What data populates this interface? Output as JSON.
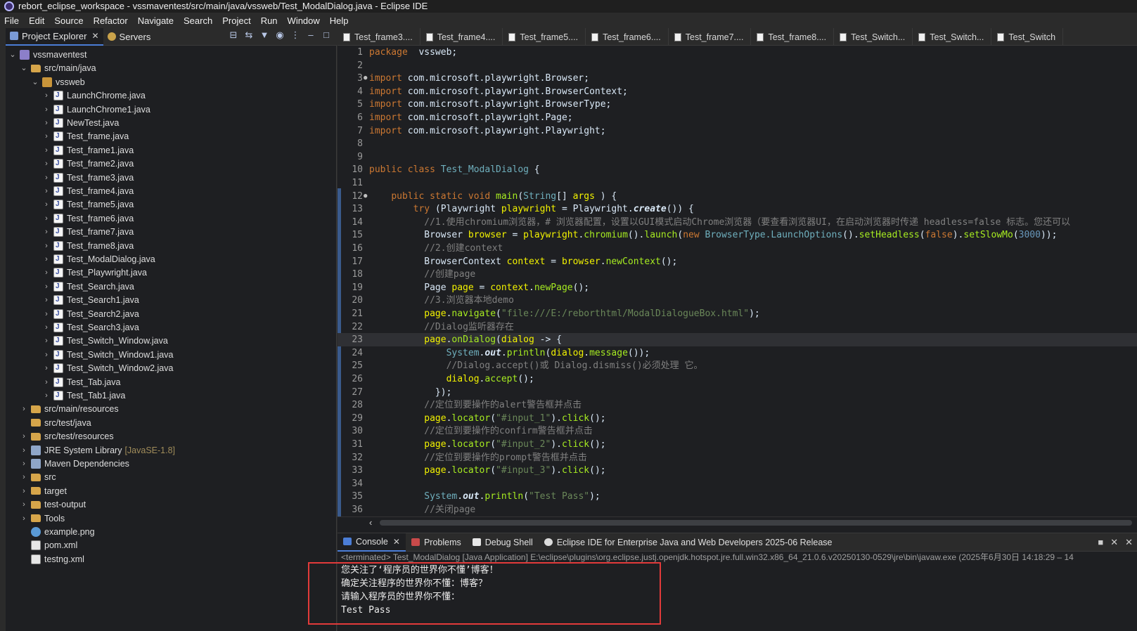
{
  "window": {
    "title": "rebort_eclipse_workspace - vssmaventest/src/main/java/vssweb/Test_ModalDialog.java - Eclipse IDE"
  },
  "menu": [
    "File",
    "Edit",
    "Source",
    "Refactor",
    "Navigate",
    "Search",
    "Project",
    "Run",
    "Window",
    "Help"
  ],
  "left_tabs": {
    "project_explorer": "Project Explorer",
    "servers": "Servers"
  },
  "tree": [
    {
      "label": "vssmaventest",
      "icon": "project",
      "level": 0,
      "chevron": "v"
    },
    {
      "label": "src/main/java",
      "icon": "folder",
      "level": 1,
      "chevron": "v"
    },
    {
      "label": "vssweb",
      "icon": "pkg",
      "level": 2,
      "chevron": "v"
    },
    {
      "label": "LaunchChrome.java",
      "icon": "java",
      "level": 3,
      "chevron": ">"
    },
    {
      "label": "LaunchChrome1.java",
      "icon": "java",
      "level": 3,
      "chevron": ">"
    },
    {
      "label": "NewTest.java",
      "icon": "java",
      "level": 3,
      "chevron": ">"
    },
    {
      "label": "Test_frame.java",
      "icon": "java",
      "level": 3,
      "chevron": ">"
    },
    {
      "label": "Test_frame1.java",
      "icon": "java",
      "level": 3,
      "chevron": ">"
    },
    {
      "label": "Test_frame2.java",
      "icon": "java",
      "level": 3,
      "chevron": ">"
    },
    {
      "label": "Test_frame3.java",
      "icon": "java",
      "level": 3,
      "chevron": ">"
    },
    {
      "label": "Test_frame4.java",
      "icon": "java",
      "level": 3,
      "chevron": ">"
    },
    {
      "label": "Test_frame5.java",
      "icon": "java",
      "level": 3,
      "chevron": ">"
    },
    {
      "label": "Test_frame6.java",
      "icon": "java",
      "level": 3,
      "chevron": ">"
    },
    {
      "label": "Test_frame7.java",
      "icon": "java",
      "level": 3,
      "chevron": ">"
    },
    {
      "label": "Test_frame8.java",
      "icon": "java",
      "level": 3,
      "chevron": ">"
    },
    {
      "label": "Test_ModalDialog.java",
      "icon": "java",
      "level": 3,
      "chevron": ">"
    },
    {
      "label": "Test_Playwright.java",
      "icon": "java",
      "level": 3,
      "chevron": ">"
    },
    {
      "label": "Test_Search.java",
      "icon": "java",
      "level": 3,
      "chevron": ">"
    },
    {
      "label": "Test_Search1.java",
      "icon": "java",
      "level": 3,
      "chevron": ">"
    },
    {
      "label": "Test_Search2.java",
      "icon": "java",
      "level": 3,
      "chevron": ">"
    },
    {
      "label": "Test_Search3.java",
      "icon": "java",
      "level": 3,
      "chevron": ">"
    },
    {
      "label": "Test_Switch_Window.java",
      "icon": "java",
      "level": 3,
      "chevron": ">"
    },
    {
      "label": "Test_Switch_Window1.java",
      "icon": "java",
      "level": 3,
      "chevron": ">"
    },
    {
      "label": "Test_Switch_Window2.java",
      "icon": "java",
      "level": 3,
      "chevron": ">"
    },
    {
      "label": "Test_Tab.java",
      "icon": "java",
      "level": 3,
      "chevron": ">"
    },
    {
      "label": "Test_Tab1.java",
      "icon": "java",
      "level": 3,
      "chevron": ">"
    },
    {
      "label": "src/main/resources",
      "icon": "folder",
      "level": 1,
      "chevron": ">"
    },
    {
      "label": "src/test/java",
      "icon": "folder",
      "level": 1,
      "chevron": ""
    },
    {
      "label": "src/test/resources",
      "icon": "folder",
      "level": 1,
      "chevron": ">"
    },
    {
      "label": "JRE System Library",
      "icon": "lib",
      "level": 1,
      "chevron": ">",
      "decoration": "[JavaSE-1.8]"
    },
    {
      "label": "Maven Dependencies",
      "icon": "lib",
      "level": 1,
      "chevron": ">"
    },
    {
      "label": "src",
      "icon": "folder",
      "level": 1,
      "chevron": ">"
    },
    {
      "label": "target",
      "icon": "folder",
      "level": 1,
      "chevron": ">"
    },
    {
      "label": "test-output",
      "icon": "folder",
      "level": 1,
      "chevron": ">"
    },
    {
      "label": "Tools",
      "icon": "folder",
      "level": 1,
      "chevron": ">"
    },
    {
      "label": "example.png",
      "icon": "png",
      "level": 1,
      "chevron": ""
    },
    {
      "label": "pom.xml",
      "icon": "xml",
      "level": 1,
      "chevron": ""
    },
    {
      "label": "testng.xml",
      "icon": "xml",
      "level": 1,
      "chevron": ""
    }
  ],
  "editor_tabs": [
    "Test_frame3....",
    "Test_frame4....",
    "Test_frame5....",
    "Test_frame6....",
    "Test_frame7....",
    "Test_frame8....",
    "Test_Switch...",
    "Test_Switch...",
    "Test_Switch"
  ],
  "code_lines": [
    {
      "n": "1",
      "segs": [
        [
          "kw",
          "package"
        ],
        [
          "",
          "  vssweb;"
        ]
      ]
    },
    {
      "n": "2",
      "segs": []
    },
    {
      "n": "3",
      "marker": true,
      "segs": [
        [
          "kw",
          "import"
        ],
        [
          "",
          " com.microsoft.playwright.Browser;"
        ]
      ]
    },
    {
      "n": "4",
      "segs": [
        [
          "kw",
          "import"
        ],
        [
          "",
          " com.microsoft.playwright.BrowserContext;"
        ]
      ]
    },
    {
      "n": "5",
      "segs": [
        [
          "kw",
          "import"
        ],
        [
          "",
          " com.microsoft.playwright.BrowserType;"
        ]
      ]
    },
    {
      "n": "6",
      "segs": [
        [
          "kw",
          "import"
        ],
        [
          "",
          " com.microsoft.playwright.Page;"
        ]
      ]
    },
    {
      "n": "7",
      "segs": [
        [
          "kw",
          "import"
        ],
        [
          "",
          " com.microsoft.playwright.Playwright;"
        ]
      ]
    },
    {
      "n": "8",
      "segs": []
    },
    {
      "n": "9",
      "segs": []
    },
    {
      "n": "10",
      "segs": [
        [
          "kw",
          "public class"
        ],
        [
          "",
          " "
        ],
        [
          "cls",
          "Test_ModalDialog"
        ],
        [
          "",
          " {"
        ]
      ]
    },
    {
      "n": "11",
      "segs": []
    },
    {
      "n": "12",
      "marker": true,
      "segs": [
        [
          "",
          "    "
        ],
        [
          "kw",
          "public static void"
        ],
        [
          "",
          " "
        ],
        [
          "mt",
          "main"
        ],
        [
          "",
          "("
        ],
        [
          "cls",
          "String"
        ],
        [
          "",
          "[] "
        ],
        [
          "vr",
          "args"
        ],
        [
          "",
          " ) {"
        ]
      ]
    },
    {
      "n": "13",
      "segs": [
        [
          "",
          "        "
        ],
        [
          "kw",
          "try"
        ],
        [
          "",
          " (Playwright "
        ],
        [
          "vr",
          "playwright"
        ],
        [
          "",
          " = Playwright."
        ],
        [
          "ital",
          "create"
        ],
        [
          "",
          "()) {"
        ]
      ]
    },
    {
      "n": "14",
      "segs": [
        [
          "",
          "          "
        ],
        [
          "cm",
          "//1.使用chromium浏览器，# 浏览器配置，设置以GUI模式启动Chrome浏览器（要查看浏览器UI，在启动浏览器时传递 headless=false 标志。您还可以"
        ]
      ]
    },
    {
      "n": "15",
      "segs": [
        [
          "",
          "          Browser "
        ],
        [
          "vr",
          "browser"
        ],
        [
          "",
          " = "
        ],
        [
          "vr",
          "playwright"
        ],
        [
          "",
          "."
        ],
        [
          "mt",
          "chromium"
        ],
        [
          "",
          "()."
        ],
        [
          "mt",
          "launch"
        ],
        [
          "",
          "("
        ],
        [
          "kw",
          "new"
        ],
        [
          "",
          " "
        ],
        [
          "cls",
          "BrowserType.LaunchOptions"
        ],
        [
          "",
          "()."
        ],
        [
          "mt",
          "setHeadless"
        ],
        [
          "",
          "("
        ],
        [
          "kw",
          "false"
        ],
        [
          "",
          ")."
        ],
        [
          "mt",
          "setSlowMo"
        ],
        [
          "",
          "("
        ],
        [
          "num",
          "3000"
        ],
        [
          "",
          "));"
        ]
      ]
    },
    {
      "n": "16",
      "segs": [
        [
          "",
          "          "
        ],
        [
          "cm",
          "//2.创建context"
        ]
      ]
    },
    {
      "n": "17",
      "segs": [
        [
          "",
          "          BrowserContext "
        ],
        [
          "vr",
          "context"
        ],
        [
          "",
          " = "
        ],
        [
          "vr",
          "browser"
        ],
        [
          "",
          "."
        ],
        [
          "mt",
          "newContext"
        ],
        [
          "",
          "();"
        ]
      ]
    },
    {
      "n": "18",
      "segs": [
        [
          "",
          "          "
        ],
        [
          "cm",
          "//创建page"
        ]
      ]
    },
    {
      "n": "19",
      "segs": [
        [
          "",
          "          Page "
        ],
        [
          "vr",
          "page"
        ],
        [
          "",
          " = "
        ],
        [
          "vr",
          "context"
        ],
        [
          "",
          "."
        ],
        [
          "mt",
          "newPage"
        ],
        [
          "",
          "();"
        ]
      ]
    },
    {
      "n": "20",
      "segs": [
        [
          "",
          "          "
        ],
        [
          "cm",
          "//3.浏览器本地demo"
        ]
      ]
    },
    {
      "n": "21",
      "segs": [
        [
          "",
          "          "
        ],
        [
          "vr",
          "page"
        ],
        [
          "",
          "."
        ],
        [
          "mt",
          "navigate"
        ],
        [
          "",
          "("
        ],
        [
          "str",
          "\"file:///E:/reborthtml/ModalDialogueBox.html\""
        ],
        [
          "",
          ");"
        ]
      ]
    },
    {
      "n": "22",
      "segs": [
        [
          "",
          "          "
        ],
        [
          "cm",
          "//Dialog监听器存在"
        ]
      ]
    },
    {
      "n": "23",
      "current": true,
      "segs": [
        [
          "",
          "          "
        ],
        [
          "vr",
          "page"
        ],
        [
          "",
          "."
        ],
        [
          "mt",
          "onDialog"
        ],
        [
          "",
          "("
        ],
        [
          "vr",
          "dialog"
        ],
        [
          "",
          " -> {"
        ]
      ]
    },
    {
      "n": "24",
      "segs": [
        [
          "",
          "              "
        ],
        [
          "cls",
          "System"
        ],
        [
          "",
          "."
        ],
        [
          "ital",
          "out"
        ],
        [
          "",
          "."
        ],
        [
          "mt",
          "println"
        ],
        [
          "",
          "("
        ],
        [
          "vr",
          "dialog"
        ],
        [
          "",
          "."
        ],
        [
          "mt",
          "message"
        ],
        [
          "",
          "());"
        ]
      ]
    },
    {
      "n": "25",
      "segs": [
        [
          "",
          "              "
        ],
        [
          "cm",
          "//Dialog.accept()或 Dialog.dismiss()必须处理 它。"
        ]
      ]
    },
    {
      "n": "26",
      "segs": [
        [
          "",
          "              "
        ],
        [
          "vr",
          "dialog"
        ],
        [
          "",
          "."
        ],
        [
          "mt",
          "accept"
        ],
        [
          "",
          "();"
        ]
      ]
    },
    {
      "n": "27",
      "segs": [
        [
          "",
          "            });"
        ]
      ]
    },
    {
      "n": "28",
      "segs": [
        [
          "",
          "          "
        ],
        [
          "cm",
          "//定位到要操作的alert警告框并点击"
        ]
      ]
    },
    {
      "n": "29",
      "segs": [
        [
          "",
          "          "
        ],
        [
          "vr",
          "page"
        ],
        [
          "",
          "."
        ],
        [
          "mt",
          "locator"
        ],
        [
          "",
          "("
        ],
        [
          "str",
          "\"#input_1\""
        ],
        [
          "",
          ")."
        ],
        [
          "mt",
          "click"
        ],
        [
          "",
          "();"
        ]
      ]
    },
    {
      "n": "30",
      "segs": [
        [
          "",
          "          "
        ],
        [
          "cm",
          "//定位到要操作的confirm警告框并点击"
        ]
      ]
    },
    {
      "n": "31",
      "segs": [
        [
          "",
          "          "
        ],
        [
          "vr",
          "page"
        ],
        [
          "",
          "."
        ],
        [
          "mt",
          "locator"
        ],
        [
          "",
          "("
        ],
        [
          "str",
          "\"#input_2\""
        ],
        [
          "",
          ")."
        ],
        [
          "mt",
          "click"
        ],
        [
          "",
          "();"
        ]
      ]
    },
    {
      "n": "32",
      "segs": [
        [
          "",
          "          "
        ],
        [
          "cm",
          "//定位到要操作的prompt警告框并点击"
        ]
      ]
    },
    {
      "n": "33",
      "segs": [
        [
          "",
          "          "
        ],
        [
          "vr",
          "page"
        ],
        [
          "",
          "."
        ],
        [
          "mt",
          "locator"
        ],
        [
          "",
          "("
        ],
        [
          "str",
          "\"#input_3\""
        ],
        [
          "",
          ")."
        ],
        [
          "mt",
          "click"
        ],
        [
          "",
          "();"
        ]
      ]
    },
    {
      "n": "34",
      "segs": []
    },
    {
      "n": "35",
      "segs": [
        [
          "",
          "          "
        ],
        [
          "cls",
          "System"
        ],
        [
          "",
          "."
        ],
        [
          "ital",
          "out"
        ],
        [
          "",
          "."
        ],
        [
          "mt",
          "println"
        ],
        [
          "",
          "("
        ],
        [
          "str",
          "\"Test Pass\""
        ],
        [
          "",
          ");"
        ]
      ]
    },
    {
      "n": "36",
      "segs": [
        [
          "",
          "          "
        ],
        [
          "cm",
          "//关闭page"
        ]
      ]
    }
  ],
  "console": {
    "tabs": {
      "console": "Console",
      "problems": "Problems",
      "debug_shell": "Debug Shell",
      "release": "Eclipse IDE for Enterprise Java and Web Developers 2025-06 Release"
    },
    "status": "<terminated> Test_ModalDialog [Java Application] E:\\eclipse\\plugins\\org.eclipse.justj.openjdk.hotspot.jre.full.win32.x86_64_21.0.6.v20250130-0529\\jre\\bin\\javaw.exe  (2025年6月30日 14:18:29 – 14",
    "output": [
      "您关注了‘程序员的世界你不懂’博客！",
      "确定关注程序的世界你不懂：博客？",
      "请输入程序员的世界你不懂：",
      "Test Pass"
    ]
  },
  "colors": {
    "highlight_box": "#e23a3a",
    "accent": "#4b7dd6"
  }
}
